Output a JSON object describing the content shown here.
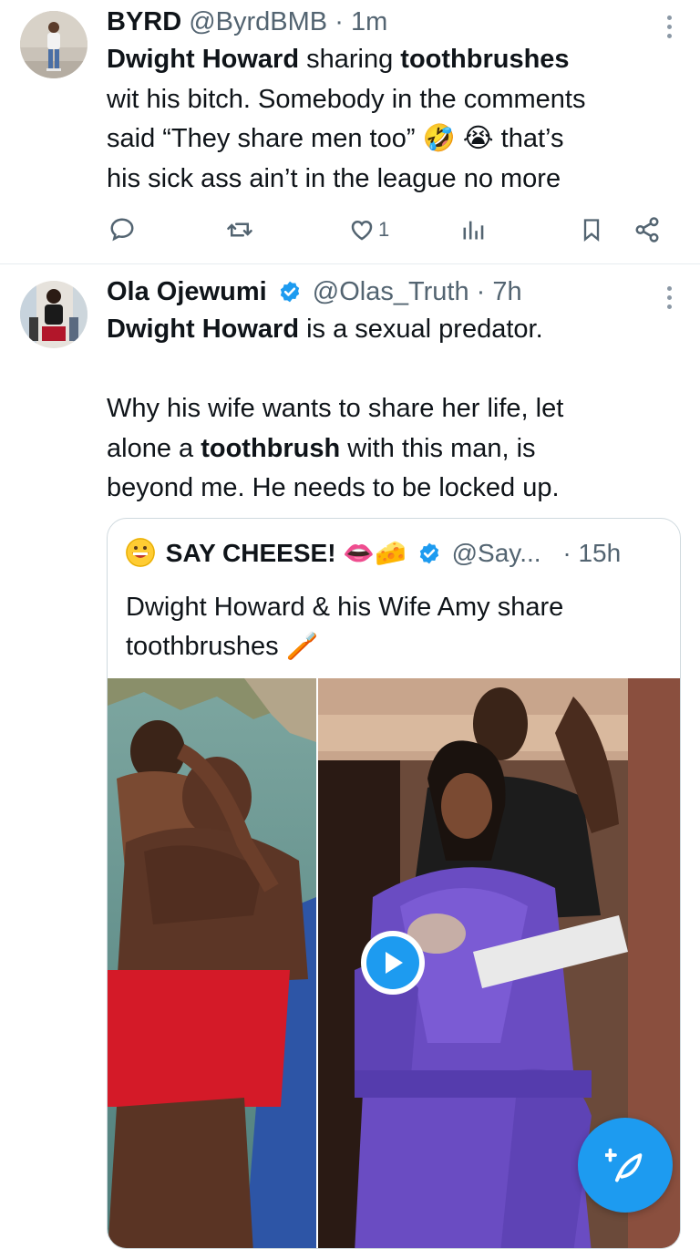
{
  "tweet1": {
    "name": "BYRD",
    "handle": "@ByrdBMB",
    "sep": "·",
    "time": "1m",
    "lines": [
      {
        "bold": "Dwight Howard",
        "mid": " sharing ",
        "bold2": "toothbrushes"
      },
      {
        "text": "wit his bitch. Somebody in the comments"
      },
      {
        "text": "said “They share men too” 🤣 😭 that’s"
      },
      {
        "text": "his sick ass ain’t in the league no more"
      }
    ],
    "likes": "1",
    "icons": [
      "reply-icon",
      "retweet-icon",
      "like-icon",
      "views-icon",
      "bookmark-icon",
      "share-icon"
    ]
  },
  "tweet2": {
    "name": "Ola Ojewumi",
    "handle": "@Olas_Truth",
    "sep": "·",
    "time": "7h",
    "line1_bold": "Dwight Howard",
    "line1_rest": " is a sexual predator.",
    "para2_line1": "Why his wife wants to share her life, let",
    "para2_line2_pre": "alone a ",
    "para2_line2_bold": "toothbrush",
    "para2_line2_post": " with this man, is",
    "para2_line3": "beyond me. He needs to be locked up."
  },
  "quote": {
    "name": "SAY CHEESE!",
    "name_emojis": "👄🧀",
    "handle": "@Say...",
    "sep": "·",
    "time": "15h",
    "text_line1": "Dwight Howard & his Wife Amy share",
    "text_line2": "toothbrushes",
    "text_emoji": "🪥"
  },
  "colors": {
    "accent": "#1d9bf0",
    "text": "#0f1419",
    "muted": "#536471",
    "border": "#cfd9de"
  }
}
